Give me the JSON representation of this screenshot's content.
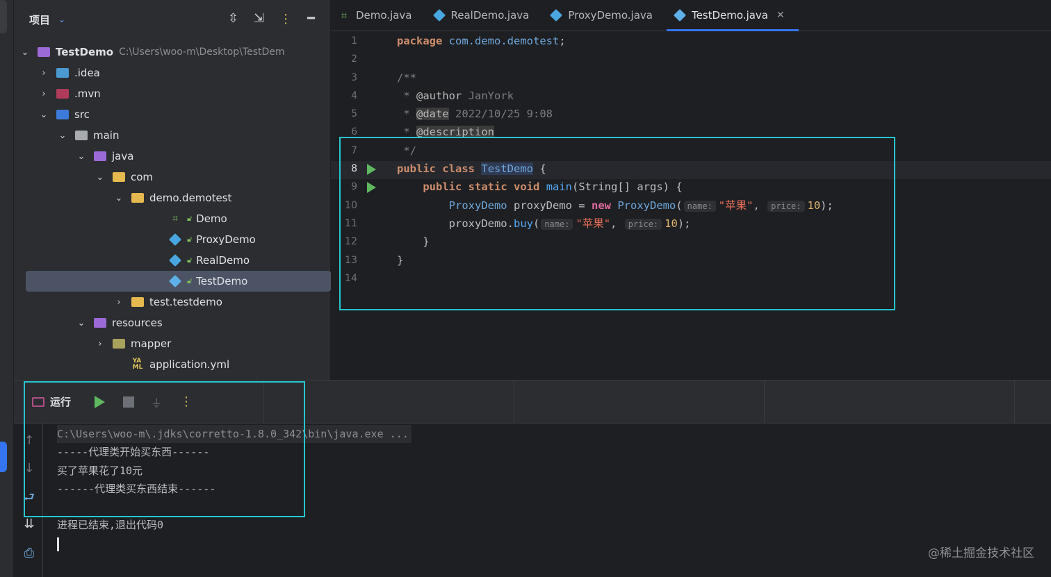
{
  "project_panel": {
    "title": "项目",
    "tree": [
      {
        "label": "TestDemo",
        "path": "C:\\Users\\woo-m\\Desktop\\TestDem",
        "indent": 0,
        "arrow": "open",
        "icon": "module-folder-icon",
        "bold": true
      },
      {
        "label": ".idea",
        "indent": 1,
        "arrow": "closed",
        "icon": "idea-folder-icon"
      },
      {
        "label": ".mvn",
        "indent": 1,
        "arrow": "closed",
        "icon": "mvn-folder-icon"
      },
      {
        "label": "src",
        "indent": 1,
        "arrow": "open",
        "icon": "src-folder-icon"
      },
      {
        "label": "main",
        "indent": 2,
        "arrow": "open",
        "icon": "folder-icon"
      },
      {
        "label": "java",
        "indent": 3,
        "arrow": "open",
        "icon": "source-root-icon"
      },
      {
        "label": "com",
        "indent": 4,
        "arrow": "open",
        "icon": "package-icon"
      },
      {
        "label": "demo.demotest",
        "indent": 5,
        "arrow": "open",
        "icon": "package-icon"
      },
      {
        "label": "Demo",
        "indent": 7,
        "arrow": "none",
        "icon": "spring-class-icon"
      },
      {
        "label": "ProxyDemo",
        "indent": 7,
        "arrow": "none",
        "icon": "class-icon"
      },
      {
        "label": "RealDemo",
        "indent": 7,
        "arrow": "none",
        "icon": "class-icon"
      },
      {
        "label": "TestDemo",
        "indent": 7,
        "arrow": "none",
        "icon": "runnable-class-icon",
        "selected": true
      },
      {
        "label": "test.testdemo",
        "indent": 5,
        "arrow": "closed",
        "icon": "package-icon"
      },
      {
        "label": "resources",
        "indent": 3,
        "arrow": "open",
        "icon": "resources-folder-icon"
      },
      {
        "label": "mapper",
        "indent": 4,
        "arrow": "closed",
        "icon": "mapper-folder-icon"
      },
      {
        "label": "application.yml",
        "indent": 5,
        "arrow": "none",
        "icon": "yaml-file-icon"
      }
    ]
  },
  "tabs": [
    {
      "label": "Demo.java",
      "icon": "spring-class-icon",
      "active": false
    },
    {
      "label": "RealDemo.java",
      "icon": "class-icon",
      "active": false
    },
    {
      "label": "ProxyDemo.java",
      "icon": "class-icon",
      "active": false
    },
    {
      "label": "TestDemo.java",
      "icon": "runnable-class-icon",
      "active": true,
      "closable": true
    }
  ],
  "editor": {
    "line_numbers": [
      "1",
      "2",
      "3",
      "4",
      "5",
      "6",
      "7",
      "8",
      "9",
      "10",
      "11",
      "12",
      "13",
      "14"
    ],
    "run_gutter_lines": [
      "8",
      "9"
    ],
    "code": {
      "l1_kw": "package",
      "l1_pkg": "com.demo.demotest",
      "l1_end": ";",
      "l3": "/**",
      "l4_star": " * ",
      "l4_tag": "@author",
      "l4_text": " JanYork",
      "l5_star": " * ",
      "l5_tag": "@date",
      "l5_text": " 2022/10/25 9:08",
      "l6_star": " * ",
      "l6_tag": "@description",
      "l7": " */",
      "l8_kw1": "public",
      "l8_kw2": "class",
      "l8_cls": "TestDemo",
      "l8_end": " {",
      "l9_indent": "    ",
      "l9_kw1": "public",
      "l9_kw2": "static",
      "l9_kw3": "void",
      "l9_fn": "main",
      "l9_rest": "(String[] args) {",
      "l10_indent": "        ",
      "l10_type": "ProxyDemo",
      "l10_var": " proxyDemo = ",
      "l10_new": "new",
      "l10_ctor": "ProxyDemo",
      "l10_paren": "(",
      "l10_hint1": "name:",
      "l10_str": "\"苹果\"",
      "l10_comma": ", ",
      "l10_hint2": "price:",
      "l10_num": "10",
      "l10_end": ");",
      "l11_indent": "        ",
      "l11_obj": "proxyDemo.",
      "l11_fn": "buy",
      "l11_paren": "(",
      "l11_hint1": "name:",
      "l11_str": "\"苹果\"",
      "l11_comma": ", ",
      "l11_hint2": "price:",
      "l11_num": "10",
      "l11_end": ");",
      "l12": "    }",
      "l13": "}"
    }
  },
  "run_panel": {
    "title": "运行",
    "console": [
      "C:\\Users\\woo-m\\.jdks\\corretto-1.8.0_342\\bin\\java.exe ...",
      "-----代理类开始买东西------",
      "买了苹果花了10元",
      "------代理类买东西结束------",
      "",
      "进程已结束,退出代码0"
    ]
  },
  "watermark": "@稀土掘金技术社区",
  "colors": {
    "highlight_box": "#26c6cf",
    "accent": "#3574f0",
    "run_green": "#5fb85f"
  }
}
